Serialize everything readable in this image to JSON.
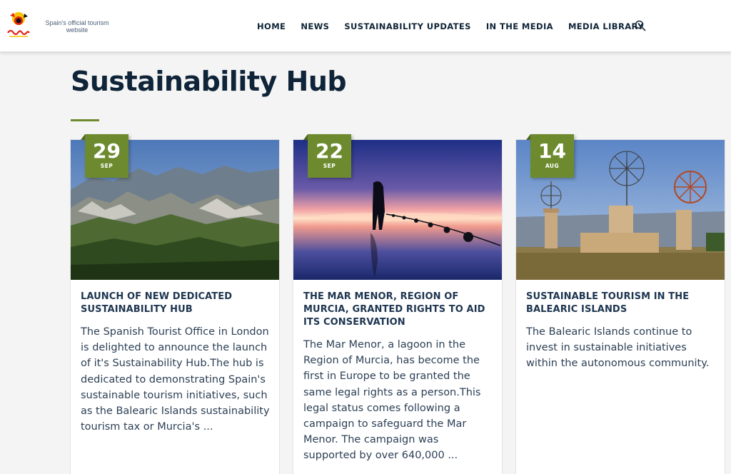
{
  "header": {
    "logo_tagline": "Spain's official tourism website",
    "nav": [
      "HOME",
      "NEWS",
      "SUSTAINABILITY UPDATES",
      "IN THE MEDIA",
      "MEDIA LIBRARY"
    ]
  },
  "page": {
    "title": "Sustainability Hub",
    "accent_color": "#6d8b2e"
  },
  "cards": [
    {
      "day": "29",
      "month": "SEP",
      "title": "LAUNCH OF NEW DEDICATED SUSTAINABILITY HUB",
      "excerpt": "The Spanish Tourist Office in London is delighted to announce the launch of it's Sustainability Hub.The hub is dedicated to demonstrating Spain's sustainable tourism initiatives, such as the Balearic Islands sustainability tourism tax or Murcia's ..."
    },
    {
      "day": "22",
      "month": "SEP",
      "title": "THE MAR MENOR, REGION OF MURCIA, GRANTED RIGHTS TO AID ITS CONSERVATION",
      "excerpt": "The Mar Menor, a lagoon in the Region of Murcia, has become the first in Europe to be granted the same legal rights as a person.This legal status comes following a campaign to safeguard the Mar Menor. The campaign was supported by over 640,000 ..."
    },
    {
      "day": "14",
      "month": "AUG",
      "title": "SUSTAINABLE TOURISM IN THE BALEARIC ISLANDS",
      "excerpt": "The Balearic Islands continue to invest in sustainable initiatives within the autonomous community."
    }
  ]
}
